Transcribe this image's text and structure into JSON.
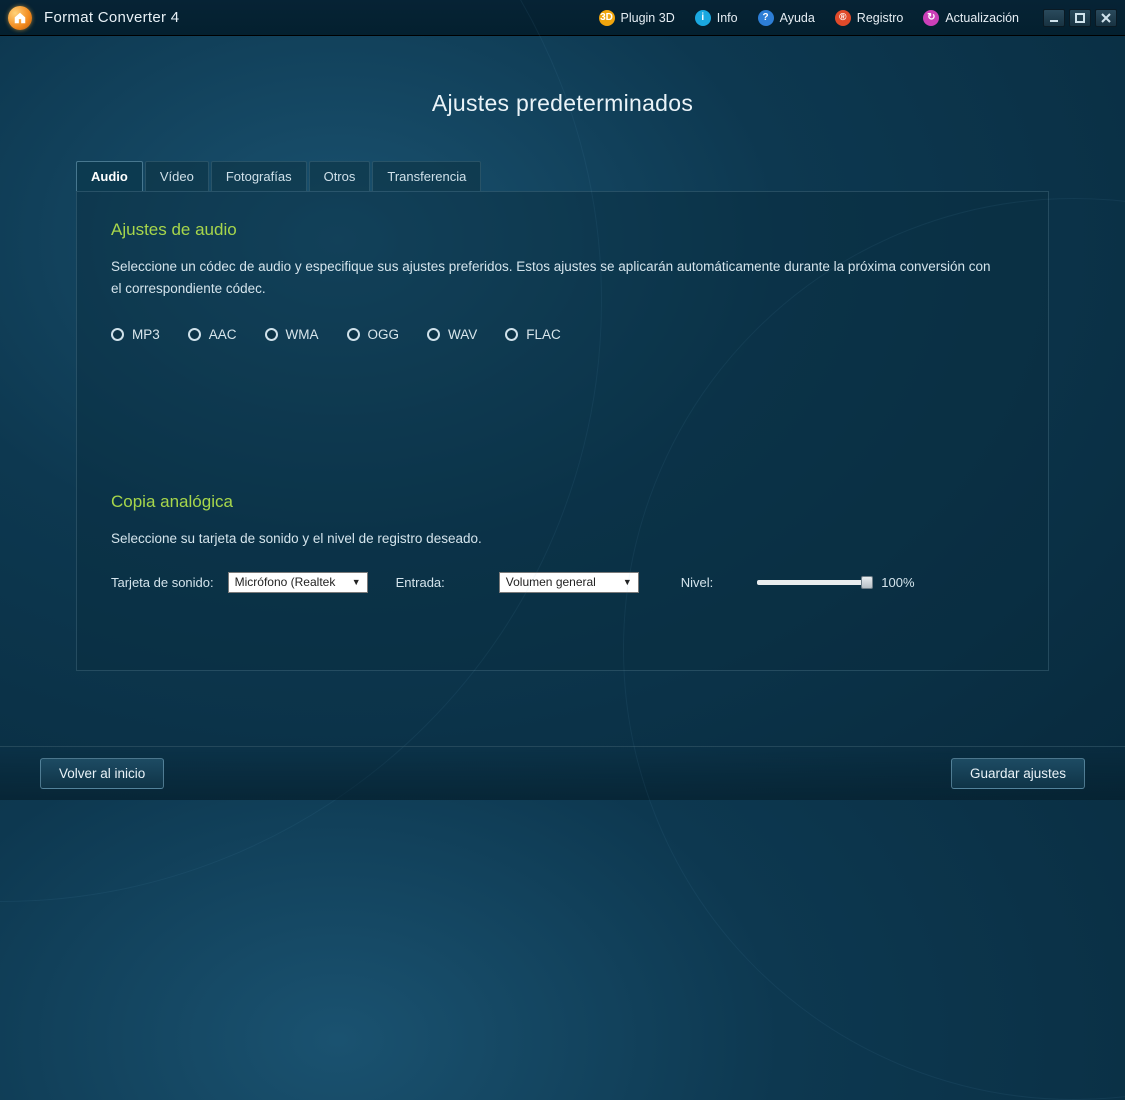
{
  "app": {
    "title": "Format Converter 4"
  },
  "titlebarLinks": [
    {
      "label": "Plugin 3D",
      "color": "#f0a50d"
    },
    {
      "label": "Info",
      "color": "#1aa8e0"
    },
    {
      "label": "Ayuda",
      "color": "#2d7ed6"
    },
    {
      "label": "Registro",
      "color": "#e04a2a"
    },
    {
      "label": "Actualización",
      "color": "#cc3fb8"
    }
  ],
  "heading": "Ajustes predeterminados",
  "tabs": [
    {
      "label": "Audio",
      "active": true
    },
    {
      "label": "Vídeo",
      "active": false
    },
    {
      "label": "Fotografías",
      "active": false
    },
    {
      "label": "Otros",
      "active": false
    },
    {
      "label": "Transferencia",
      "active": false
    }
  ],
  "audio": {
    "section_title": "Ajustes de audio",
    "section_desc": "Seleccione un códec de audio y especifique sus ajustes preferidos. Estos ajustes se aplicarán automáticamente durante la próxima conversión con el correspondiente códec.",
    "codecs": [
      "MP3",
      "AAC",
      "WMA",
      "OGG",
      "WAV",
      "FLAC"
    ]
  },
  "analog": {
    "section_title": "Copia analógica",
    "section_desc": "Seleccione su tarjeta de sonido y el nivel de registro deseado.",
    "soundcard_label": "Tarjeta de sonido:",
    "soundcard_value": "Micrófono (Realtek",
    "input_label": "Entrada:",
    "input_value": "Volumen general",
    "level_label": "Nivel:",
    "level_value": "100%"
  },
  "footer": {
    "back": "Volver al inicio",
    "save": "Guardar ajustes"
  }
}
